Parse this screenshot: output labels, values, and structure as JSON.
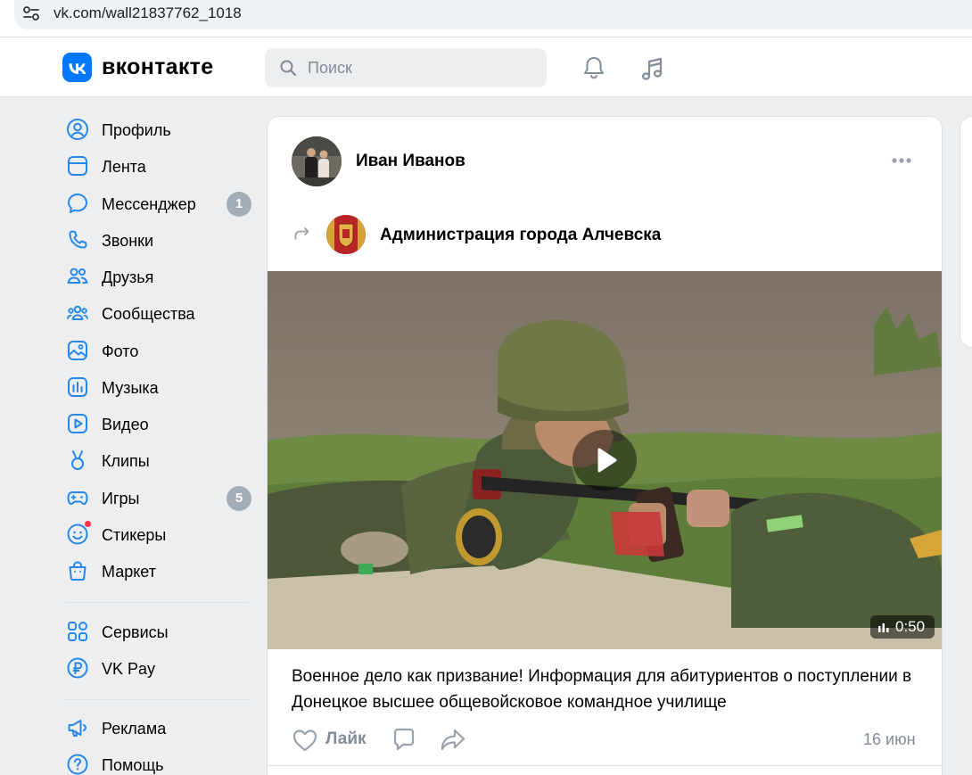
{
  "browser": {
    "url": "vk.com/wall21837762_1018"
  },
  "header": {
    "logo_text": "вконтакте",
    "search_placeholder": "Поиск"
  },
  "menu": {
    "items": [
      {
        "id": "profile",
        "label": "Профиль",
        "icon": "profile-icon"
      },
      {
        "id": "feed",
        "label": "Лента",
        "icon": "feed-icon"
      },
      {
        "id": "messenger",
        "label": "Мессенджер",
        "icon": "messenger-icon",
        "badge": "1"
      },
      {
        "id": "calls",
        "label": "Звонки",
        "icon": "phone-icon"
      },
      {
        "id": "friends",
        "label": "Друзья",
        "icon": "friends-icon"
      },
      {
        "id": "communities",
        "label": "Сообщества",
        "icon": "communities-icon"
      },
      {
        "id": "photos",
        "label": "Фото",
        "icon": "photo-icon"
      },
      {
        "id": "music",
        "label": "Музыка",
        "icon": "music-chart-icon"
      },
      {
        "id": "video",
        "label": "Видео",
        "icon": "video-icon"
      },
      {
        "id": "clips",
        "label": "Клипы",
        "icon": "clips-icon"
      },
      {
        "id": "games",
        "label": "Игры",
        "icon": "gamepad-icon",
        "badge": "5"
      },
      {
        "id": "stickers",
        "label": "Стикеры",
        "icon": "sticker-icon"
      },
      {
        "id": "market",
        "label": "Маркет",
        "icon": "bag-icon"
      },
      {
        "id": "services",
        "label": "Сервисы",
        "icon": "grid-icon"
      },
      {
        "id": "vkpay",
        "label": "VK Pay",
        "icon": "ruble-icon"
      },
      {
        "id": "ads",
        "label": "Реклама",
        "icon": "megaphone-icon"
      },
      {
        "id": "help",
        "label": "Помощь",
        "icon": "help-icon"
      }
    ]
  },
  "post": {
    "author": "Иван Иванов",
    "source_group": "Администрация города Алчевска",
    "video_duration": "0:50",
    "text": "Военное дело как призвание! Информация для абитуриентов о поступлении в Донецкое высшее общевойсковое командное училище",
    "like_label": "Лайк",
    "date": "16 июн"
  },
  "colors": {
    "accent": "#0077ff",
    "badge": "#a3adb8",
    "secondary_text": "#818c99",
    "notification_dot": "#ff3347"
  }
}
